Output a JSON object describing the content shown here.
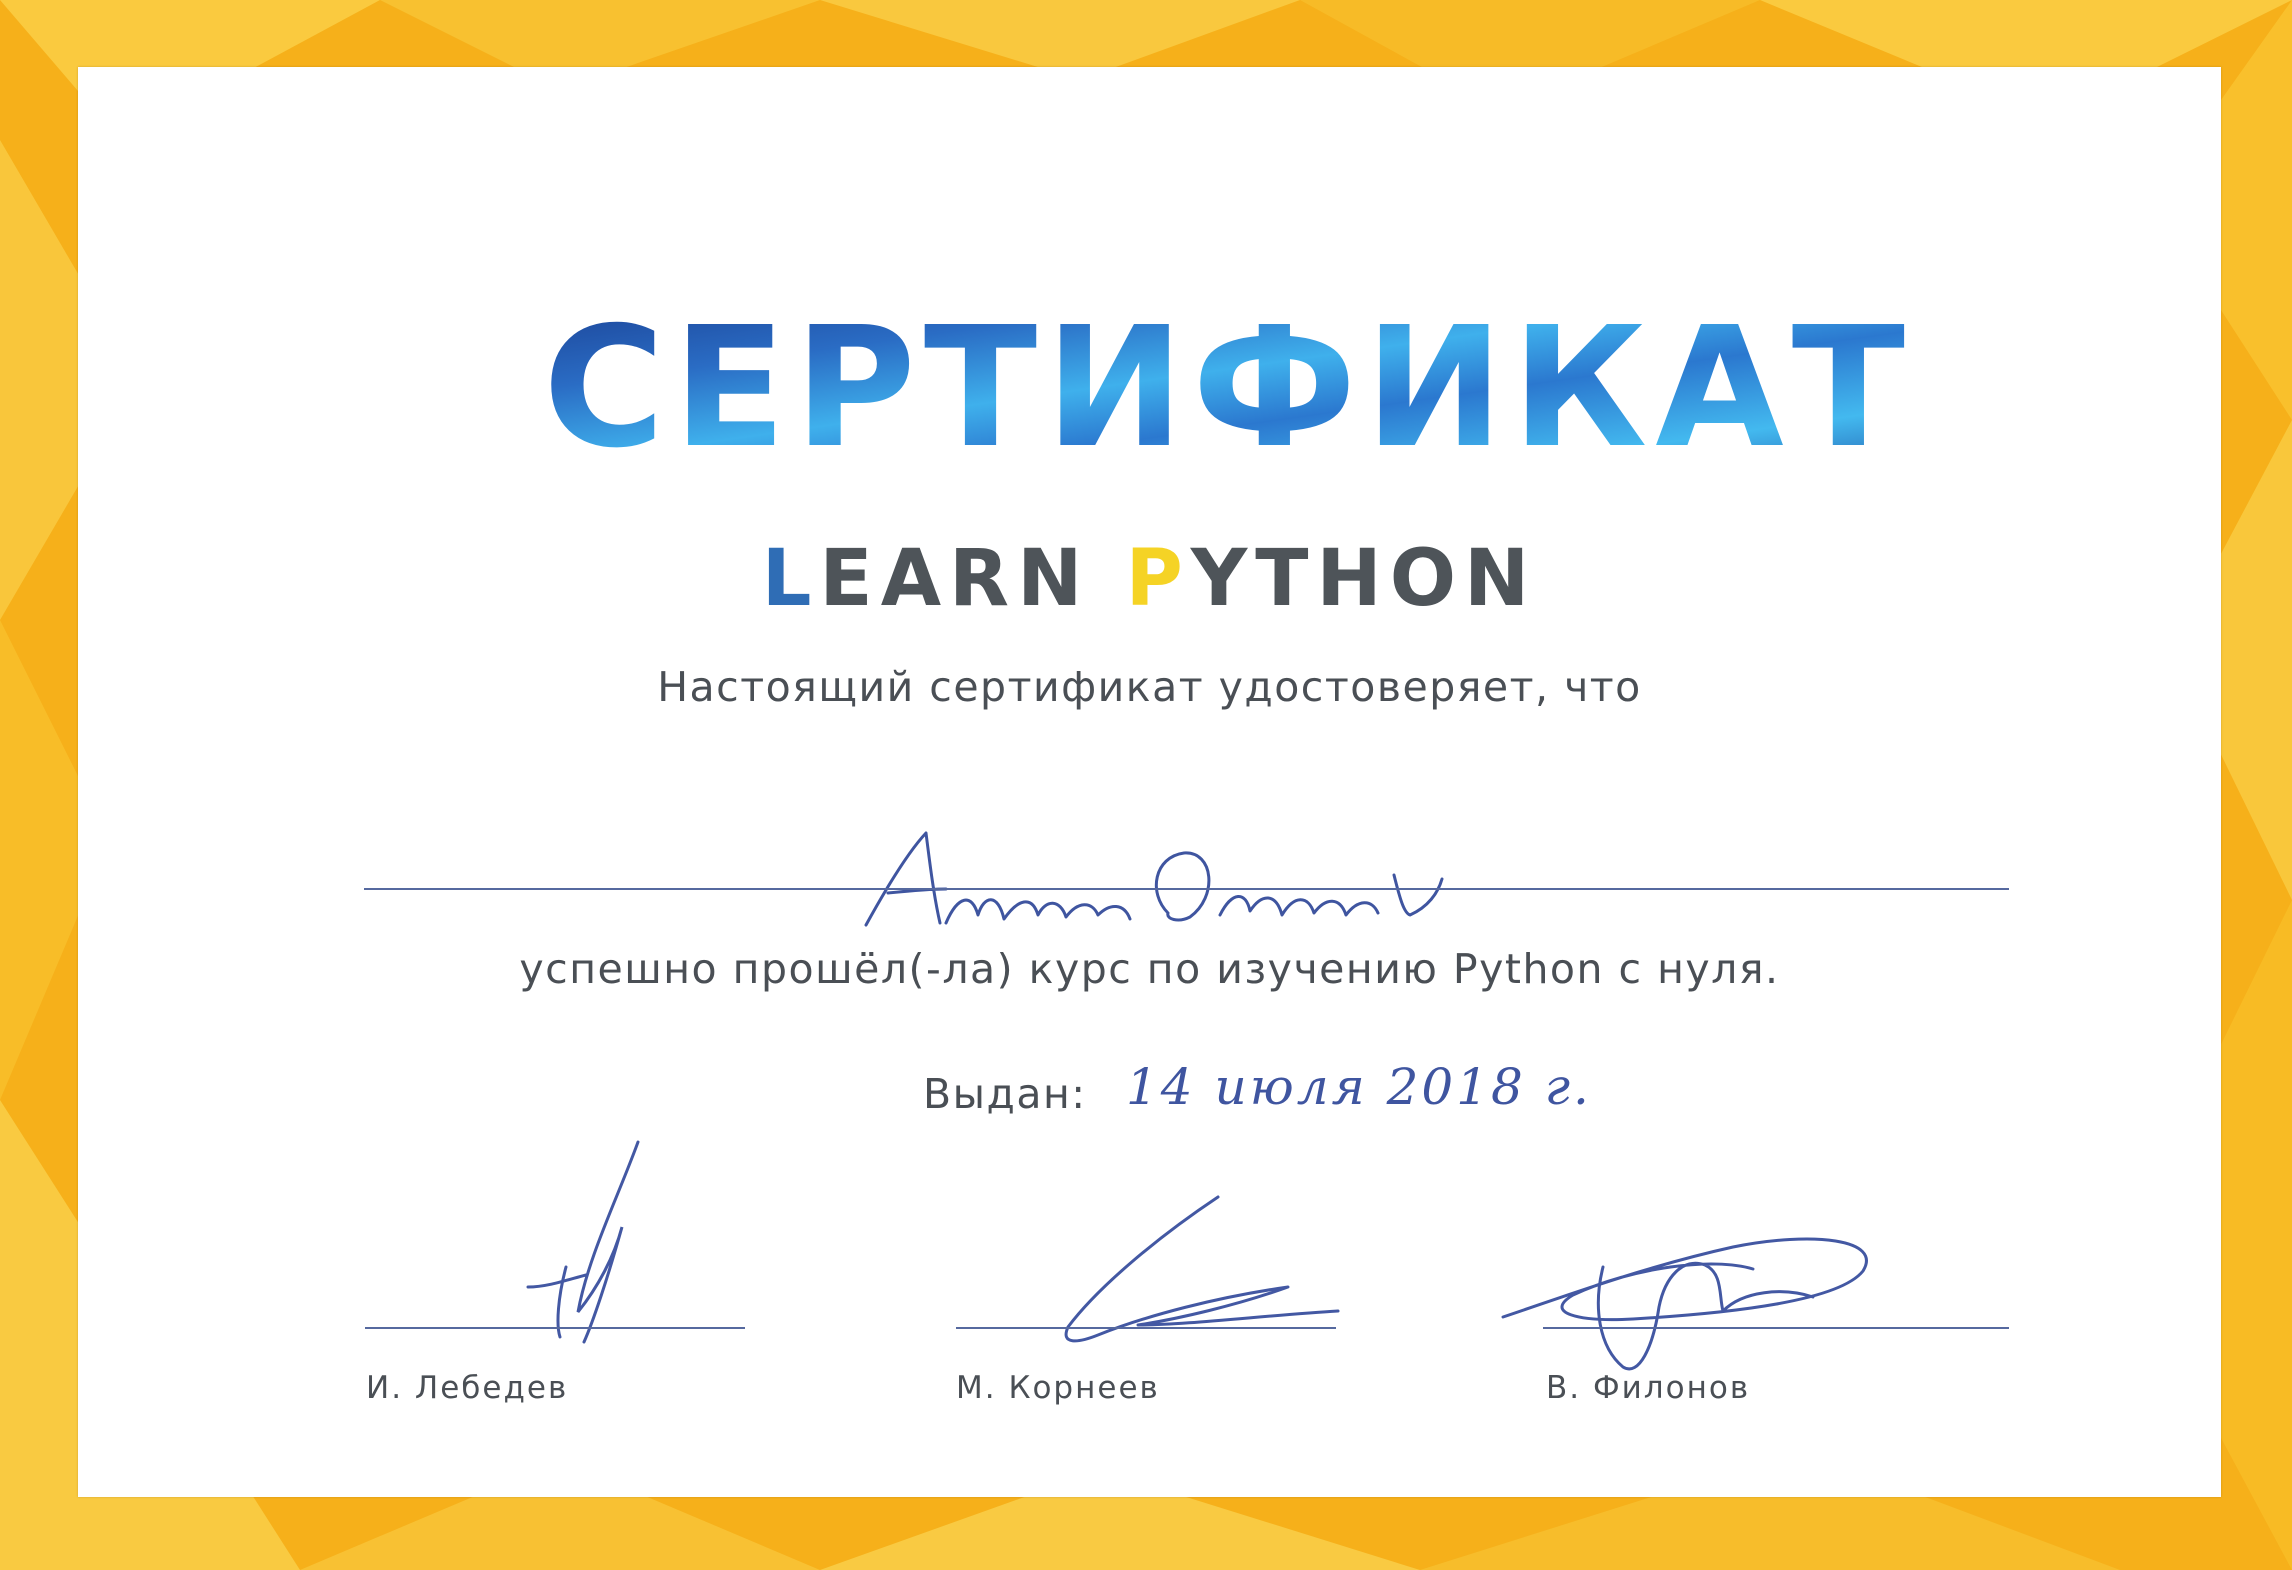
{
  "certificate": {
    "title": "СЕРТИФИКАТ",
    "subtitle": {
      "first_letter": "L",
      "first_rest": "EARN ",
      "second_letter": "P",
      "second_rest": "YTHON"
    },
    "intro_text": "Настоящий сертификат удостоверяет, что",
    "recipient_name": "",
    "completion_text": "успешно прошёл(-ла) курс по изучению Python с нуля.",
    "issued_label": "Выдан:",
    "issue_date": "14 июля 2018 г.",
    "signatories": [
      {
        "name": "И. Лебедев"
      },
      {
        "name": "М. Корнеев"
      },
      {
        "name": "В. Филонов"
      }
    ]
  },
  "colors": {
    "border_yellow": "#f7b41c",
    "border_light": "#fbd04a",
    "title_blue_dark": "#1d4fa2",
    "title_blue_light": "#3fb4ee",
    "accent_blue": "#2f6db5",
    "accent_yellow": "#f5d325",
    "text_gray": "#4a4f55",
    "ink_blue": "#3f55a0",
    "paper": "#ffffff"
  }
}
